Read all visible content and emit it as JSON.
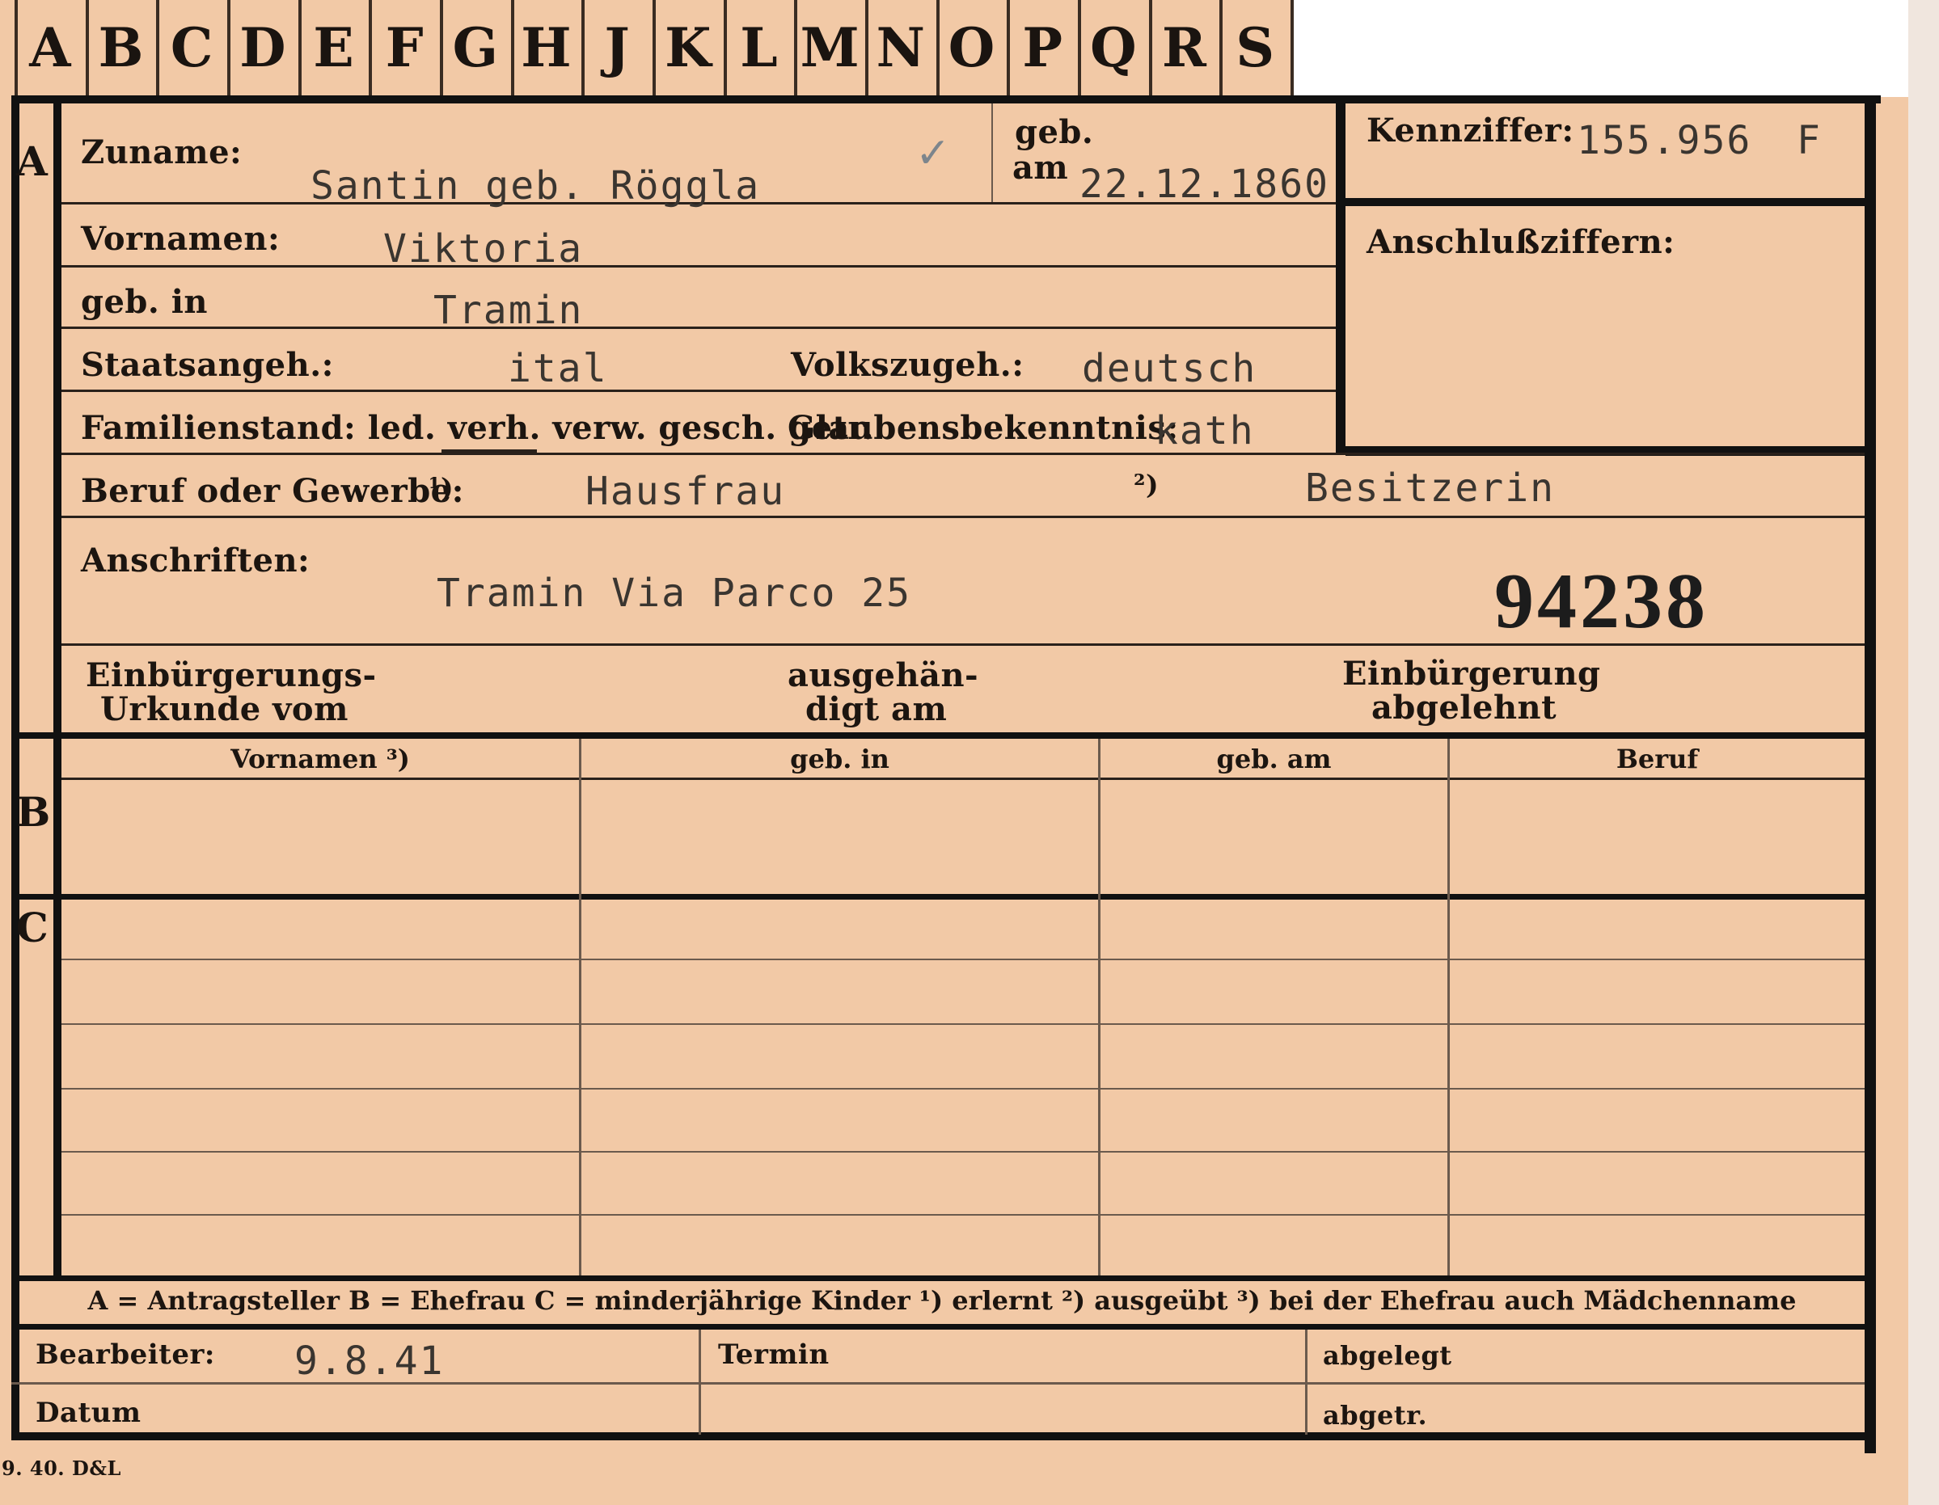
{
  "index_tabs": [
    "A",
    "B",
    "C",
    "D",
    "E",
    "F",
    "G",
    "H",
    "J",
    "K",
    "L",
    "M",
    "N",
    "O",
    "P",
    "Q",
    "R",
    "S"
  ],
  "section_letters": {
    "a": "A",
    "b": "B",
    "c": "C"
  },
  "fields": {
    "zuname_label": "Zuname:",
    "zuname_value": "Santin geb. Röggla",
    "geb_label": "geb.",
    "am_label": "am",
    "geb_am_value": "22.12.1860",
    "vornamen_label": "Vornamen:",
    "vornamen_value": "Viktoria",
    "geb_in_label": "geb. in",
    "geb_in_value": "Tramin",
    "staatsangeh_label": "Staatsangeh.:",
    "staatsangeh_value": "ital",
    "volkszugeh_label": "Volkszugeh.:",
    "volkszugeh_value": "deutsch",
    "familienstand_label": "Familienstand: led. verh. verw. gesch. getr.",
    "glaubens_label": "Glaubensbekenntnis:",
    "glaubens_value": "kath",
    "beruf_label": "Beruf oder Gewerbe:",
    "beruf_note1": "¹)",
    "beruf_value1": "Hausfrau",
    "beruf_note2": "²)",
    "beruf_value2": "Besitzerin",
    "anschriften_label": "Anschriften:",
    "anschriften_value": "Tramin Via Parco 25",
    "big_number": "94238",
    "einb_urkunde_line1": "Einbürgerungs-",
    "einb_urkunde_line2": "Urkunde vom",
    "ausgehaendigt_line1": "ausgehän-",
    "ausgehaendigt_line2": "digt am",
    "einb_abgelehnt_line1": "Einbürgerung",
    "einb_abgelehnt_line2": "abgelehnt",
    "kennziffer_label": "Kennziffer:",
    "kennziffer_value": "155.956",
    "kennziffer_suffix": "F",
    "anschlussziffern_label": "Anschlußziffern:"
  },
  "table_headers": [
    "Vornamen ³)",
    "geb. in",
    "geb. am",
    "Beruf"
  ],
  "legend": "A = Antragsteller   B = Ehefrau   C = minderjährige Kinder   ¹) erlernt   ²) ausgeübt   ³) bei der Ehefrau auch Mädchenname",
  "footer": {
    "bearbeiter_label": "Bearbeiter:",
    "bearbeiter_value": "9.8.41",
    "datum_label": "Datum",
    "termin_label": "Termin",
    "abgelegt_label": "abgelegt",
    "abgetr_label": "abgetr."
  },
  "print_mark": "9. 40. D&L",
  "colors": {
    "card": "#f2c9a6",
    "ink": "#1a1410",
    "typewriter": "#3a3530",
    "border": "#111111"
  }
}
